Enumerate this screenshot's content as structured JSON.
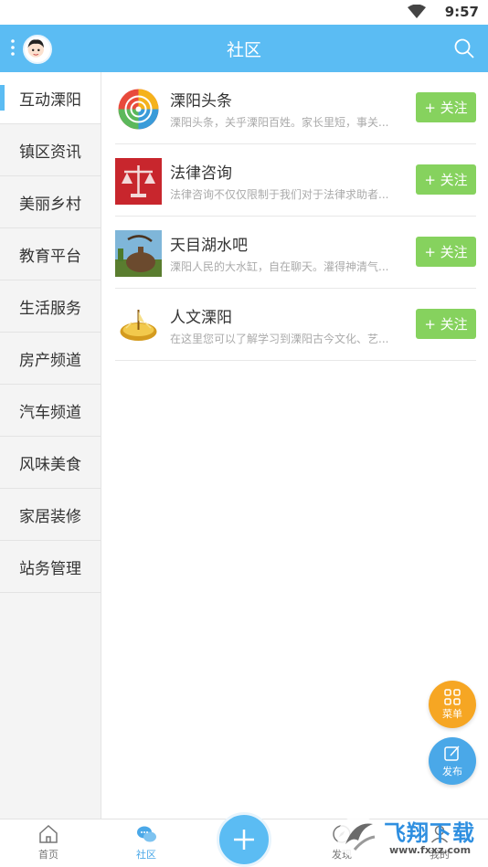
{
  "status_bar": {
    "time": "9:57",
    "wifi_icon": "wifi-icon"
  },
  "header": {
    "title": "社区",
    "menu_icon": "more-vertical-icon",
    "avatar_icon": "avatar",
    "search_icon": "search-icon",
    "bg_color": "#5bbcf3"
  },
  "sidebar": {
    "items": [
      {
        "label": "互动溧阳",
        "active": true
      },
      {
        "label": "镇区资讯"
      },
      {
        "label": "美丽乡村"
      },
      {
        "label": "教育平台"
      },
      {
        "label": "生活服务"
      },
      {
        "label": "房产频道"
      },
      {
        "label": "汽车频道"
      },
      {
        "label": "风味美食"
      },
      {
        "label": "家居装修"
      },
      {
        "label": "站务管理"
      }
    ],
    "accent_color": "#5bbcf3"
  },
  "forums": [
    {
      "name": "溧阳头条",
      "desc": "溧阳头条，关乎溧阳百姓。家长里短，事关...",
      "follow": "+ 关注",
      "icon": "pinwheel-icon"
    },
    {
      "name": "法律咨询",
      "desc": "法律咨询不仅仅限制于我们对于法律求助者...",
      "follow": "+ 关注",
      "icon": "scales-of-justice-icon"
    },
    {
      "name": "天目湖水吧",
      "desc": "溧阳人民的大水缸，自在聊天。灌得神清气...",
      "follow": "+ 关注",
      "icon": "teapot-photo-icon"
    },
    {
      "name": "人文溧阳",
      "desc": "在这里您可以了解学习到溧阳古今文化、艺...",
      "follow": "+ 关注",
      "icon": "sundial-icon"
    }
  ],
  "fabs": {
    "menu_label": "菜单",
    "post_label": "发布",
    "menu_color": "#f6a623",
    "post_color": "#4aa8e8"
  },
  "tabbar": {
    "tabs": [
      {
        "label": "首页",
        "icon": "home-icon"
      },
      {
        "label": "社区",
        "icon": "community-icon",
        "active": true
      },
      {
        "label": "发现",
        "icon": "discover-icon"
      },
      {
        "label": "我的",
        "icon": "profile-icon"
      }
    ],
    "center_icon": "plus-icon"
  },
  "watermark": {
    "text": "飞翔下载",
    "url": "www.fxxz.com"
  }
}
